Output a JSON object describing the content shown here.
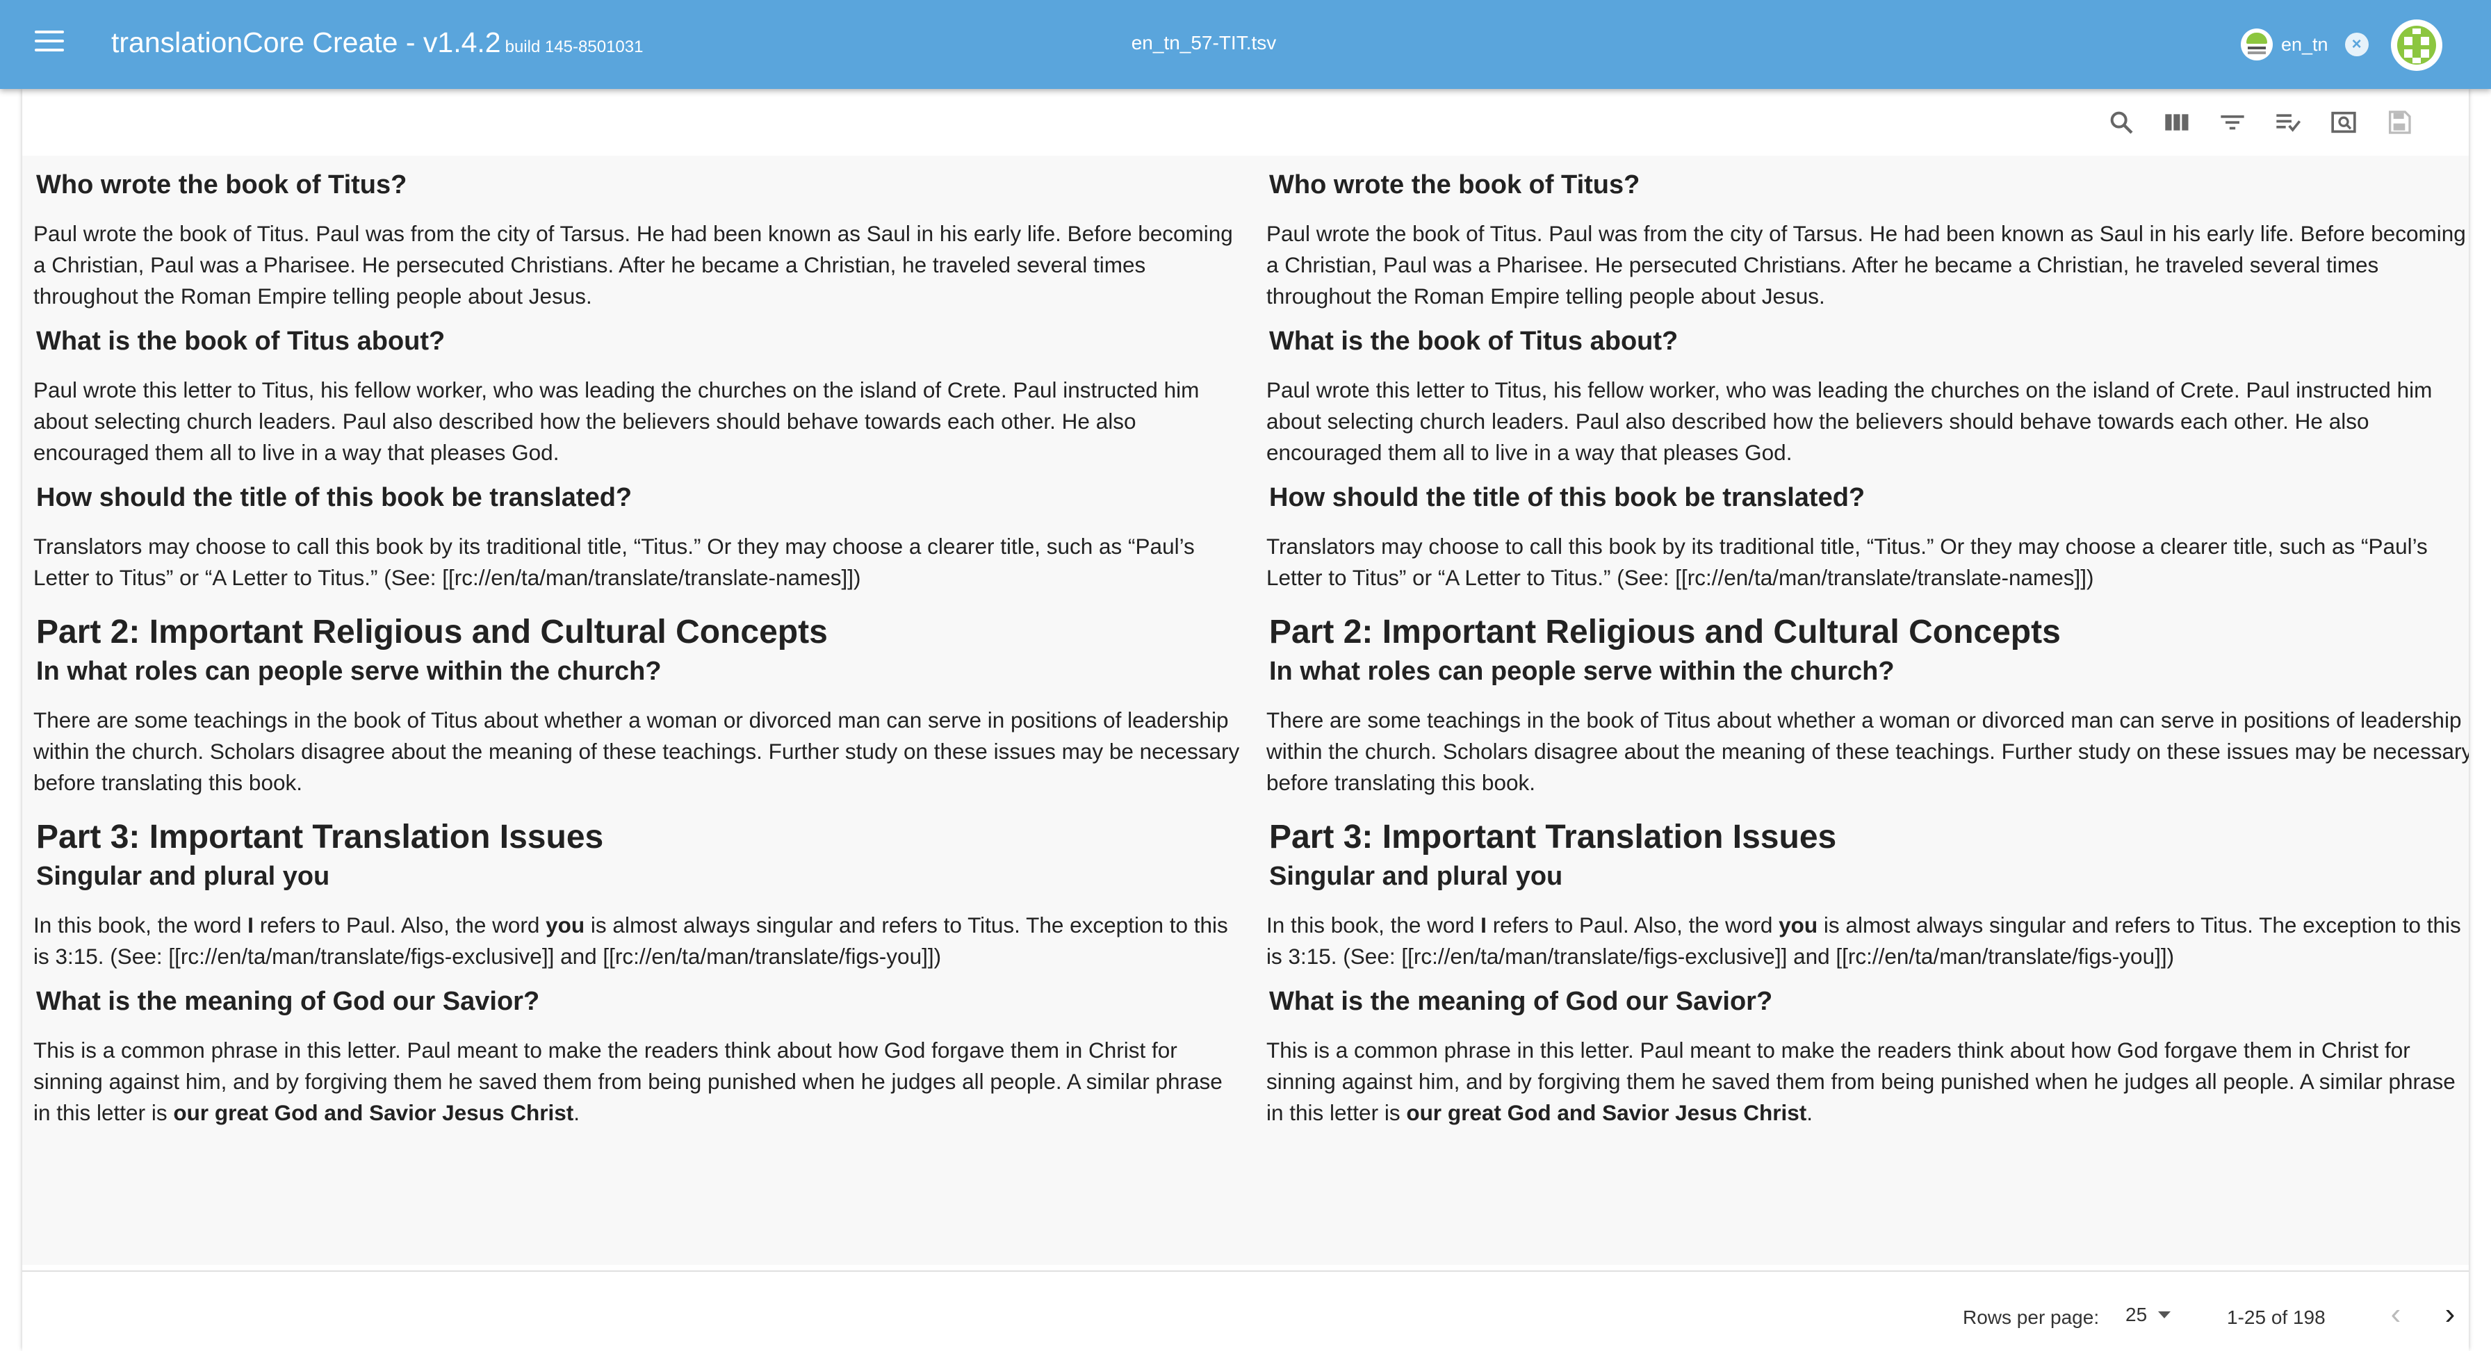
{
  "header": {
    "app_title": "translationCore Create - v1.4.2",
    "build": "build 145-8501031",
    "file_name": "en_tn_57-TIT.tsv",
    "user_label": "en_tn",
    "close_symbol": "×"
  },
  "colors": {
    "app_bar": "#5aa5dc",
    "brand_green": "#8cc63f",
    "content_bg": "#f8f8f8"
  },
  "toolbar": {
    "icons": [
      "search-icon",
      "view-columns-icon",
      "filter-list-icon",
      "playlist-check-icon",
      "preview-icon",
      "save-icon"
    ]
  },
  "columns": {
    "left": {
      "h_who": "Who wrote the book of Titus?",
      "p_who": "Paul wrote the book of Titus. Paul was from the city of Tarsus. He had been known as Saul in his early life. Before becoming a Christian, Paul was a Pharisee. He persecuted Christians. After he became a Christian, he traveled several times throughout the Roman Empire telling people about Jesus.",
      "h_about": "What is the book of Titus about?",
      "p_about": "Paul wrote this letter to Titus, his fellow worker, who was leading the churches on the island of Crete. Paul instructed him about selecting church leaders. Paul also described how the believers should behave towards each other. He also encouraged them all to live in a way that pleases God.",
      "h_title": "How should the title of this book be translated?",
      "p_title": "Translators may choose to call this book by its traditional title, “Titus.” Or they may choose a clearer title, such as “Paul’s Letter to Titus” or “A Letter to Titus.” (See: [[rc://en/ta/man/translate/translate-names]])",
      "part2": "Part 2: Important Religious and Cultural Concepts",
      "h_roles": "In what roles can people serve within the church?",
      "p_roles": "There are some teachings in the book of Titus about whether a woman or divorced man can serve in positions of leadership within the church. Scholars disagree about the meaning of these teachings. Further study on these issues may be necessary before translating this book.",
      "part3": "Part 3: Important Translation Issues",
      "h_you": "Singular and plural you",
      "p_you_1": "In this book, the word ",
      "p_you_I": "I",
      "p_you_2": " refers to Paul. Also, the word ",
      "p_you_you": "you",
      "p_you_3": " is almost always singular and refers to Titus. The exception to this is 3:15. (See: [[rc://en/ta/man/translate/figs-exclusive]] and [[rc://en/ta/man/translate/figs-you]])",
      "h_savior": "What is the meaning of God our Savior?",
      "p_savior_1": "This is a common phrase in this letter. Paul meant to make the readers think about how God forgave them in Christ for sinning against him, and by forgiving them he saved them from being punished when he judges all people. A similar phrase in this letter is ",
      "p_savior_bold": "our great God and Savior Jesus Christ",
      "p_savior_2": "."
    },
    "right": {
      "h_who": "Who wrote the book of Titus?",
      "p_who": "Paul wrote the book of Titus. Paul was from the city of Tarsus. He had been known as Saul in his early life. Before becoming a Christian, Paul was a Pharisee. He persecuted Christians. After he became a Christian, he traveled several times throughout the Roman Empire telling people about Jesus.",
      "h_about": "What is the book of Titus about?",
      "p_about": "Paul wrote this letter to Titus, his fellow worker, who was leading the churches on the island of Crete. Paul instructed him about selecting church leaders. Paul also described how the believers should behave towards each other. He also encouraged them all to live in a way that pleases God.",
      "h_title": "How should the title of this book be translated?",
      "p_title": "Translators may choose to call this book by its traditional title, “Titus.” Or they may choose a clearer title, such as “Paul’s Letter to Titus” or “A Letter to Titus.” (See: [[rc://en/ta/man/translate/translate-names]])",
      "part2": "Part 2: Important Religious and Cultural Concepts",
      "h_roles": "In what roles can people serve within the church?",
      "p_roles": "There are some teachings in the book of Titus about whether a woman or divorced man can serve in positions of leadership within the church. Scholars disagree about the meaning of these teachings. Further study on these issues may be necessary before translating this book.",
      "part3": "Part 3: Important Translation Issues",
      "h_you": "Singular and plural you",
      "p_you_1": "In this book, the word ",
      "p_you_I": "I",
      "p_you_2": " refers to Paul. Also, the word ",
      "p_you_you": "you",
      "p_you_3": " is almost always singular and refers to Titus. The exception to this is 3:15. (See: [[rc://en/ta/man/translate/figs-exclusive]] and [[rc://en/ta/man/translate/figs-you]])",
      "h_savior": "What is the meaning of God our Savior?",
      "p_savior_1": "This is a common phrase in this letter. Paul meant to make the readers think about how God forgave them in Christ for sinning against him, and by forgiving them he saved them from being punished when he judges all people. A similar phrase in this letter is ",
      "p_savior_bold": "our great God and Savior Jesus Christ",
      "p_savior_2": "."
    }
  },
  "pagination": {
    "rows_label": "Rows per page:",
    "rows_value": "25",
    "range": "1-25 of 198",
    "prev": "‹",
    "next": "›"
  }
}
